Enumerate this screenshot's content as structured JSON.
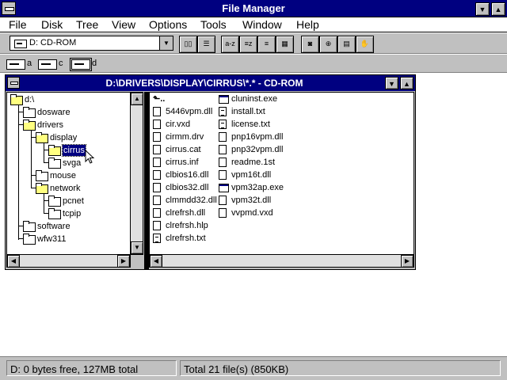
{
  "app": {
    "title": "File Manager"
  },
  "menu": {
    "items": [
      {
        "label": "File",
        "underline": "F"
      },
      {
        "label": "Disk",
        "underline": "D"
      },
      {
        "label": "Tree",
        "underline": "T"
      },
      {
        "label": "View",
        "underline": "V"
      },
      {
        "label": "Options",
        "underline": "O"
      },
      {
        "label": "Tools",
        "underline": "T"
      },
      {
        "label": "Window",
        "underline": "W"
      },
      {
        "label": "Help",
        "underline": "H"
      }
    ]
  },
  "toolbar": {
    "drive_select": "D: CD-ROM",
    "buttons": [
      {
        "name": "view-tree-button",
        "icon": "tree-view-icon"
      },
      {
        "name": "view-details-button",
        "icon": "details-view-icon"
      },
      {
        "name": "sort-by-name-button",
        "icon": "sort-name-icon"
      },
      {
        "name": "sort-by-type-button",
        "icon": "sort-type-icon"
      },
      {
        "name": "sort-by-size-button",
        "icon": "sort-size-icon"
      },
      {
        "name": "sort-by-date-button",
        "icon": "sort-date-icon"
      },
      {
        "name": "connect-drive-button",
        "icon": "connect-drive-icon"
      },
      {
        "name": "disconnect-drive-button",
        "icon": "disconnect-drive-icon"
      },
      {
        "name": "share-as-button",
        "icon": "share-icon"
      },
      {
        "name": "stop-sharing-button",
        "icon": "stop-share-icon"
      }
    ]
  },
  "drives": [
    {
      "letter": "a",
      "selected": false
    },
    {
      "letter": "c",
      "selected": false
    },
    {
      "letter": "d",
      "selected": true
    }
  ],
  "child_window": {
    "title": "D:\\DRIVERS\\DISPLAY\\CIRRUS\\*.* - CD-ROM"
  },
  "tree": {
    "root": "d:\\",
    "nodes": [
      {
        "label": "dosware",
        "level": 1
      },
      {
        "label": "drivers",
        "level": 1
      },
      {
        "label": "display",
        "level": 2
      },
      {
        "label": "cirrus",
        "level": 3,
        "selected": true
      },
      {
        "label": "svga",
        "level": 3
      },
      {
        "label": "mouse",
        "level": 2
      },
      {
        "label": "network",
        "level": 2
      },
      {
        "label": "pcnet",
        "level": 3
      },
      {
        "label": "tcpip",
        "level": 3
      },
      {
        "label": "software",
        "level": 1
      },
      {
        "label": "wfw311",
        "level": 1
      }
    ]
  },
  "files": {
    "col1": [
      {
        "name": "5446vpm.dll",
        "type": "doc"
      },
      {
        "name": "cir.vxd",
        "type": "doc"
      },
      {
        "name": "cirmm.drv",
        "type": "doc"
      },
      {
        "name": "cirrus.cat",
        "type": "doc"
      },
      {
        "name": "cirrus.inf",
        "type": "doc"
      },
      {
        "name": "clbios16.dll",
        "type": "doc"
      },
      {
        "name": "clbios32.dll",
        "type": "doc"
      },
      {
        "name": "clmmdd32.dll",
        "type": "doc"
      },
      {
        "name": "clrefrsh.dll",
        "type": "doc"
      },
      {
        "name": "clrefrsh.hlp",
        "type": "doc"
      },
      {
        "name": "clrefrsh.txt",
        "type": "txt"
      }
    ],
    "col2": [
      {
        "name": "cluninst.exe",
        "type": "exe"
      },
      {
        "name": "install.txt",
        "type": "txt"
      },
      {
        "name": "license.txt",
        "type": "txt"
      },
      {
        "name": "pnp16vpm.dll",
        "type": "doc"
      },
      {
        "name": "pnp32vpm.dll",
        "type": "doc"
      },
      {
        "name": "readme.1st",
        "type": "doc"
      },
      {
        "name": "vpm16t.dll",
        "type": "doc"
      },
      {
        "name": "vpm32ap.exe",
        "type": "exe"
      },
      {
        "name": "vpm32t.dll",
        "type": "doc"
      },
      {
        "name": "vvpmd.vxd",
        "type": "doc"
      }
    ]
  },
  "status": {
    "disk": "D: 0 bytes free,  127MB total",
    "files": "Total 21 file(s) (850KB)"
  }
}
